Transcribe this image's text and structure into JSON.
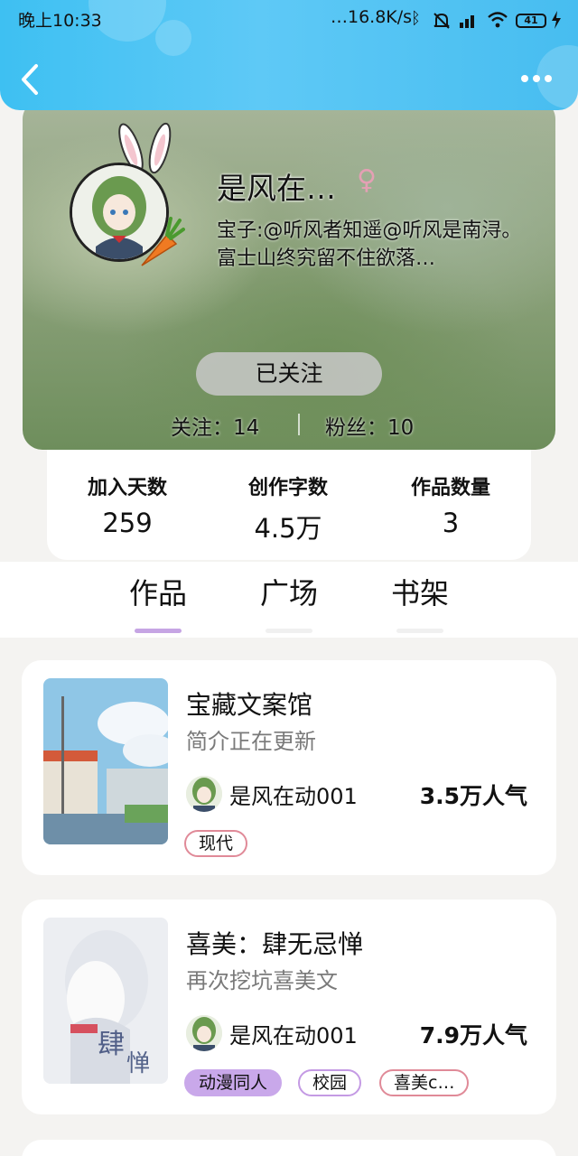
{
  "status_bar": {
    "time": "晚上10:33",
    "network_speed": "…16.8K/s",
    "battery": "41"
  },
  "header": {
    "back_icon": "chevron-left-icon",
    "more_icon": "more-dots-icon"
  },
  "profile": {
    "username": "是风在…",
    "gender_symbol": "♀",
    "bio": "宝子:@听风者知遥@听风是南浔。富士山终究留不住欲落…",
    "follow_button": "已关注",
    "following_label": "关注：14",
    "followers_label": "粉丝：10"
  },
  "stats": [
    {
      "label": "加入天数",
      "value": "259"
    },
    {
      "label": "创作字数",
      "value": "4.5万"
    },
    {
      "label": "作品数量",
      "value": "3"
    }
  ],
  "tabs": [
    {
      "label": "作品",
      "active": true
    },
    {
      "label": "广场",
      "active": false
    },
    {
      "label": "书架",
      "active": false
    }
  ],
  "books": [
    {
      "title": "宝藏文案馆",
      "description": "简介正在更新",
      "author": "是风在动001",
      "popularity": "3.5万人气",
      "tags": [
        "现代"
      ]
    },
    {
      "title": "喜美：肆无忌惮",
      "description": "再次挖坑喜美文",
      "author": "是风在动001",
      "popularity": "7.9万人气",
      "tags": [
        "动漫同人",
        "校园",
        "喜美c…"
      ]
    }
  ]
}
